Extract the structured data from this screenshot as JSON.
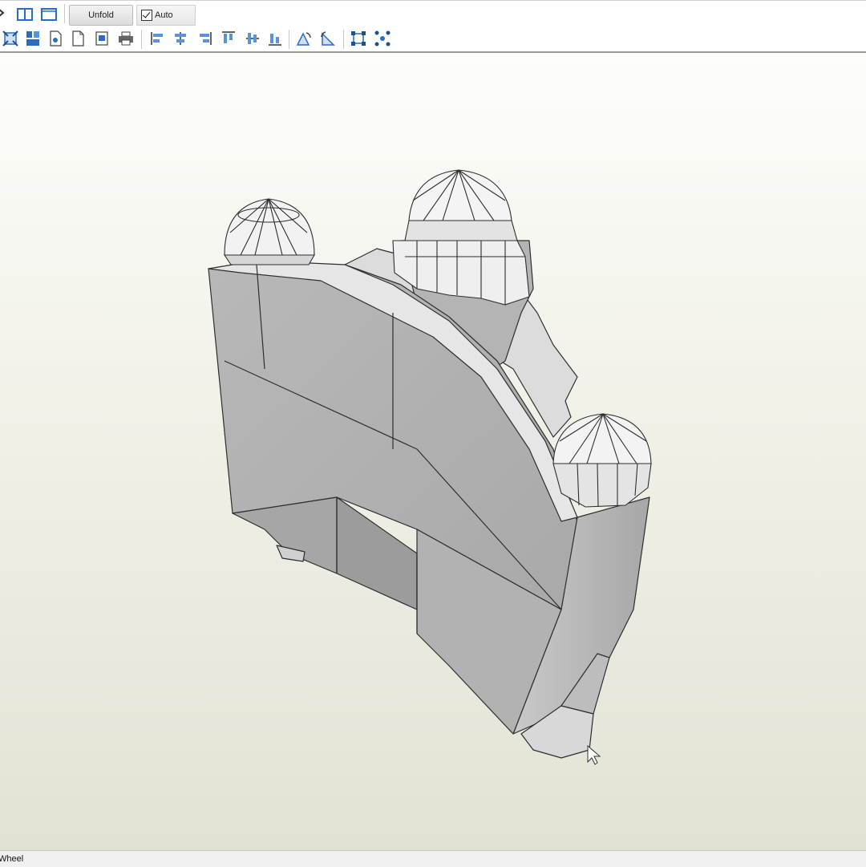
{
  "toolbar": {
    "unfold_label": "Unfold",
    "auto_label": "Auto",
    "auto_checked": true,
    "accent_color": "#2a6cc4",
    "row1_icons": [
      "view-split-icon",
      "view-single-icon"
    ],
    "row2_icons": [
      "fit-view-icon",
      "texture-icon",
      "page-icon",
      "page-setup-icon",
      "print-preview-icon",
      "print-icon",
      "align-left-icon",
      "align-center-icon",
      "align-right-icon",
      "align-top-icon",
      "align-middle-icon",
      "align-bottom-icon",
      "rotate-left-icon",
      "rotate-right-icon",
      "select-edge-icon",
      "select-vertex-icon"
    ]
  },
  "viewport": {
    "background_top": "#fdfdfb",
    "background_bottom": "#e2e2d4",
    "model_color": "#c4c4c4",
    "content": "3d-papercraft-model"
  },
  "status_bar": {
    "text": "Wheel"
  }
}
